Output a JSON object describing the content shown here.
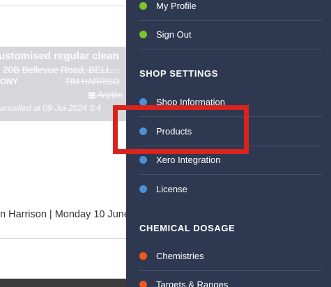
{
  "background_page": {
    "job_card": {
      "title": "ustomised regular clean",
      "address": "20B Bellevue Road, BELL...",
      "customer": "ONY",
      "technician": "TIM HARRISO",
      "time": "Anytim",
      "cancelled": "ancelled at 09-Jul-2024 3:4"
    },
    "log_line": "n Harrison | Monday 10 June"
  },
  "side_menu": {
    "account_items": [
      {
        "label": "My Profile",
        "dot_color": "#7cc52a"
      },
      {
        "label": "Sign Out",
        "dot_color": "#7cc52a"
      }
    ],
    "shop_settings": {
      "title": "SHOP SETTINGS",
      "items": [
        {
          "label": "Shop Information",
          "dot_color": "#4a90d9"
        },
        {
          "label": "Products",
          "dot_color": "#4a90d9"
        },
        {
          "label": "Xero Integration",
          "dot_color": "#4a90d9"
        },
        {
          "label": "License",
          "dot_color": "#4a90d9"
        }
      ]
    },
    "chemical_dosage": {
      "title": "CHEMICAL DOSAGE",
      "items": [
        {
          "label": "Chemistries",
          "dot_color": "#f0581e"
        },
        {
          "label": "Targets & Ranges",
          "dot_color": "#f0581e"
        }
      ]
    }
  },
  "highlight": {
    "color": "#d9231d",
    "target": "Products"
  }
}
